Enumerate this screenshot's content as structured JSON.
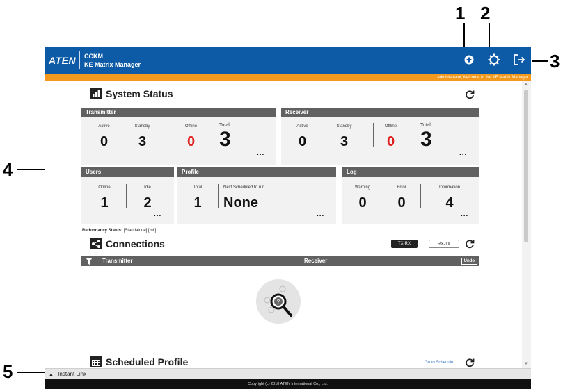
{
  "callouts": {
    "c1": "1",
    "c2": "2",
    "c3": "3",
    "c4": "4",
    "c5": "5"
  },
  "header": {
    "logo": "ATEN",
    "app_title_line1": "CCKM",
    "app_title_line2": "KE Matrix Manager",
    "icons": [
      "add-icon",
      "settings-gear-icon",
      "logout-icon"
    ]
  },
  "welcome": "administrator,Welcome to the KE Matrix Manager",
  "system_status": {
    "title": "System Status",
    "transmitter": {
      "title": "Transmitter",
      "labels": {
        "active": "Active",
        "standby": "Standby",
        "offline": "Offline",
        "total": "Total"
      },
      "values": {
        "active": "0",
        "standby": "3",
        "offline": "0",
        "total": "3"
      },
      "more": "..."
    },
    "receiver": {
      "title": "Receiver",
      "labels": {
        "active": "Active",
        "standby": "Standby",
        "offline": "Offline",
        "total": "Total"
      },
      "values": {
        "active": "0",
        "standby": "3",
        "offline": "0",
        "total": "3"
      },
      "more": "..."
    },
    "users": {
      "title": "Users",
      "labels": {
        "online": "Online",
        "idle": "Idle"
      },
      "values": {
        "online": "1",
        "idle": "2"
      },
      "more": "..."
    },
    "profile": {
      "title": "Profile",
      "labels": {
        "total": "Total",
        "next": "Next Scheduled to run"
      },
      "values": {
        "total": "1",
        "next": "None"
      },
      "more": "..."
    },
    "log": {
      "title": "Log",
      "labels": {
        "warning": "Warning",
        "error": "Error",
        "information": "Information"
      },
      "values": {
        "warning": "0",
        "error": "0",
        "information": "4"
      },
      "more": "..."
    },
    "offline_color": "#e02020"
  },
  "redundancy": {
    "label": "Redundancy Status:",
    "value": "[Standalone] [Init]"
  },
  "connections": {
    "title": "Connections",
    "toggle_active": "TX-RX",
    "toggle_inactive": "RX-TX",
    "columns": {
      "transmitter": "Transmitter",
      "receiver": "Receiver"
    },
    "undo": "Undo"
  },
  "scheduled": {
    "title": "Scheduled Profile",
    "link": "Go to Schedule"
  },
  "instant_link": "Instant Link",
  "footer": "Copyright (c) 2018 ATEN International Co., Ltd.",
  "colors": {
    "topbar": "#0d5ba6",
    "welcome": "#f39a1e",
    "panel_head": "#616161"
  }
}
